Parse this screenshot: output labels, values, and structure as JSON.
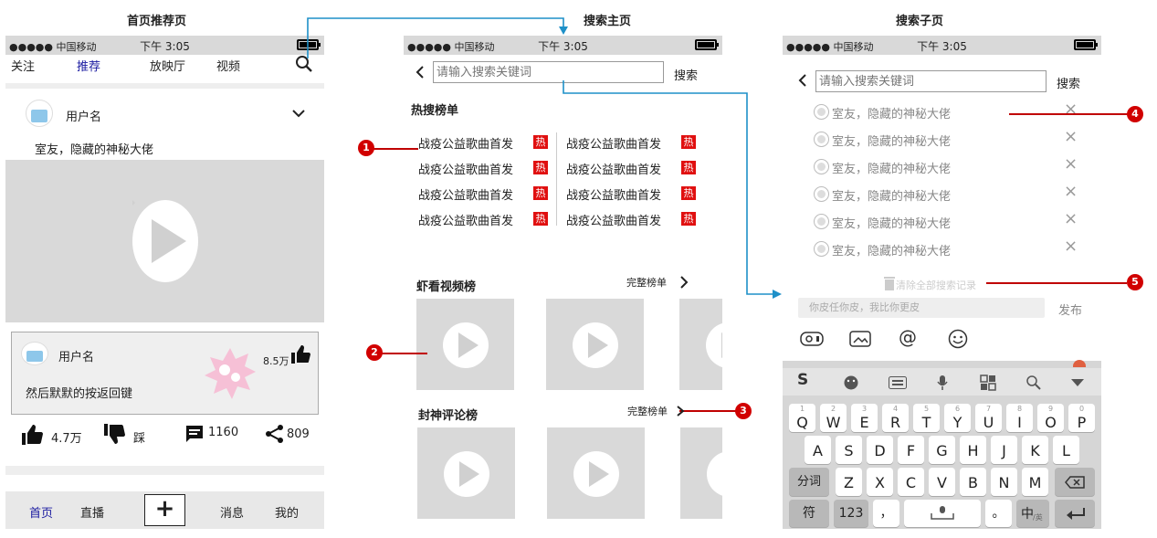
{
  "titles": {
    "home": "首页推荐页",
    "search_main": "搜索主页",
    "search_sub": "搜索子页"
  },
  "status_bar": {
    "carrier": "●●●●● 中国移动",
    "time": "下午 3:05"
  },
  "home": {
    "tabs": [
      "关注",
      "推荐",
      "放映厅",
      "视频"
    ],
    "post": {
      "username": "用户名",
      "caption": "室友，隐藏的神秘大佬"
    },
    "comment": {
      "username": "用户名",
      "text": "然后默默的按返回键",
      "likes": "8.5万"
    },
    "actions": {
      "likes": "4.7万",
      "dislike": "踩",
      "comments": "1160",
      "shares": "809"
    },
    "bottom_nav": {
      "home": "首页",
      "live": "直播",
      "add": "+",
      "messages": "消息",
      "me": "我的"
    }
  },
  "search_main": {
    "placeholder": "请输入搜索关键词",
    "search_button": "搜索",
    "hot_title": "热搜榜单",
    "hot_items": [
      "战疫公益歌曲首发",
      "战疫公益歌曲首发",
      "战疫公益歌曲首发",
      "战疫公益歌曲首发"
    ],
    "hot_items_right": [
      "战疫公益歌曲首发",
      "战疫公益歌曲首发",
      "战疫公益歌曲首发",
      "战疫公益歌曲首发"
    ],
    "hot_tag": "热",
    "video_rank_title": "虾看视频榜",
    "comment_rank_title": "封神评论榜",
    "full_list": "完整榜单"
  },
  "search_sub": {
    "placeholder": "请输入搜索关键词",
    "search_button": "搜索",
    "history": [
      "室友，隐藏的神秘大佬",
      "室友，隐藏的神秘大佬",
      "室友，隐藏的神秘大佬",
      "室友，隐藏的神秘大佬",
      "室友，隐藏的神秘大佬",
      "室友，隐藏的神秘大佬"
    ],
    "clear_history": "清除全部搜索记录",
    "comment_placeholder": "你皮任你皮，我比你更皮",
    "publish": "发布",
    "keyboard": {
      "row1": [
        "Q",
        "W",
        "E",
        "R",
        "T",
        "Y",
        "U",
        "I",
        "O",
        "P"
      ],
      "row1_nums": [
        "1",
        "2",
        "3",
        "4",
        "5",
        "6",
        "7",
        "8",
        "9",
        "0"
      ],
      "row2": [
        "A",
        "S",
        "D",
        "F",
        "G",
        "H",
        "J",
        "K",
        "L"
      ],
      "row3": [
        "Z",
        "X",
        "C",
        "V",
        "B",
        "N",
        "M"
      ],
      "fenci": "分词",
      "symbol": "符",
      "num": "123",
      "comma": "，",
      "period": "。",
      "cn": "中",
      "cn_sub": "/英"
    }
  },
  "badges": [
    "1",
    "2",
    "3",
    "4",
    "5"
  ],
  "colors": {
    "arrow": "#1e90c8",
    "annotation": "#c00000",
    "hot": "#e01010",
    "active_tab": "#1a1aa0"
  }
}
